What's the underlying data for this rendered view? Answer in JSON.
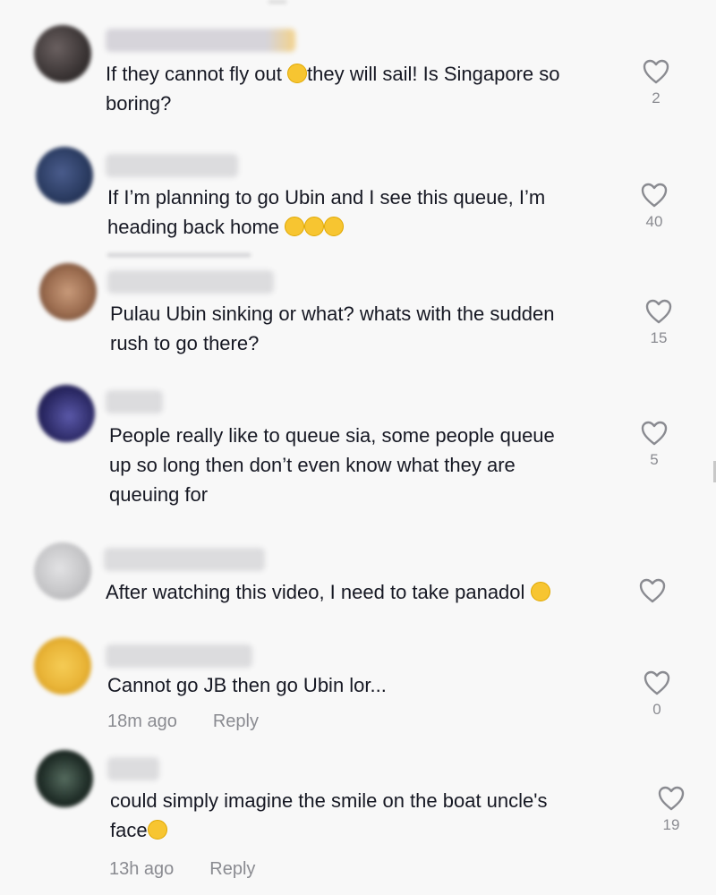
{
  "comments": [
    {
      "avatar_color": "#3a3434",
      "username_color": "#d9d6dd",
      "text_before_emoji": "If they cannot fly out ",
      "emoji": "flushed-face-emoji",
      "text_after_emoji": "they will sail! Is Singapore so\nboring?",
      "likes": "2"
    },
    {
      "avatar_color": "#2c3d63",
      "text": "If I’m planning to go Ubin and I see this queue, I’m\nheading back home ",
      "emoji": "tears-of-joy-emoji",
      "likes": "40"
    },
    {
      "avatar_color": "#9a6b4e",
      "text": "Pulau Ubin sinking or what? whats with the sudden\nrush to go there?",
      "likes": "15"
    },
    {
      "avatar_color": "#2c2a66",
      "text": "People really like to queue sia, some people queue\nup so long then don’t even know what they are\nqueuing for",
      "likes": "5"
    },
    {
      "avatar_color": "#c6c6c8",
      "text": "After watching this video, I need to take panadol ",
      "emoji": "pleading-face-emoji",
      "likes": ""
    },
    {
      "avatar_color": "#e9b437",
      "text": "Cannot go JB then go Ubin lor...",
      "time": "18m ago",
      "reply_label": "Reply",
      "likes": "0"
    },
    {
      "avatar_color": "#22302a",
      "text": "could simply imagine the smile on the boat uncle's\nface",
      "emoji": "grinning-face-emoji",
      "time": "13h ago",
      "reply_label": "Reply",
      "likes": "19"
    }
  ],
  "colors": {
    "background": "#f8f8f8",
    "text": "#161823",
    "muted": "#8a8b91",
    "heart_stroke": "#8a8b91"
  }
}
